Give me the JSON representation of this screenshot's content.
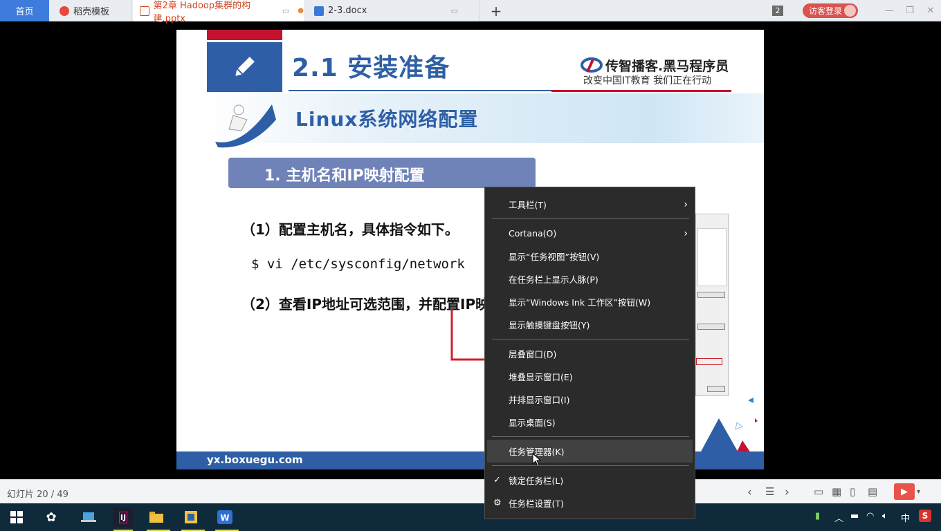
{
  "tabs": {
    "home": "首页",
    "docer": "稻壳模板",
    "ppt": "第2章 Hadoop集群的构建.pptx",
    "docx": "2-3.docx",
    "plus": "+",
    "count": "2",
    "visitor": "访客登录"
  },
  "slide": {
    "title": "2.1  安装准备",
    "brand_name": "传智播客.黑马程序员",
    "brand_slogan": "改变中国IT教育 我们正在行动",
    "banner": "Linux系统网络配置",
    "section": "1.  主机名和IP映射配置",
    "item1": "（1）配置主机名，具体指令如下。",
    "command": "$ vi /etc/sysconfig/network",
    "item2": "（2）查看IP地址可选范围，并配置IP映",
    "footer": "yx.boxuegu.com"
  },
  "statusbar": {
    "slide_counter": "幻灯片 20 / 49"
  },
  "context_menu": {
    "items": [
      {
        "label": "工具栏(T)",
        "submenu": true
      },
      {
        "label": "Cortana(O)",
        "submenu": true
      },
      {
        "label": "显示“任务视图”按钮(V)"
      },
      {
        "label": "在任务栏上显示人脉(P)"
      },
      {
        "label": "显示“Windows Ink 工作区”按钮(W)"
      },
      {
        "label": "显示触摸键盘按钮(Y)"
      },
      {
        "label": "层叠窗口(D)"
      },
      {
        "label": "堆叠显示窗口(E)"
      },
      {
        "label": "并排显示窗口(I)"
      },
      {
        "label": "显示桌面(S)"
      },
      {
        "label": "任务管理器(K)",
        "highlighted": true
      },
      {
        "label": "锁定任务栏(L)",
        "checked": true
      },
      {
        "label": "任务栏设置(T)",
        "icon": "gear-icon"
      }
    ]
  },
  "tray": {
    "ime": "中"
  },
  "colors": {
    "accent_blue": "#2e5fa6",
    "accent_red": "#c41230",
    "home_tab": "#3d7bdc",
    "menu_bg": "#2b2b2b"
  }
}
